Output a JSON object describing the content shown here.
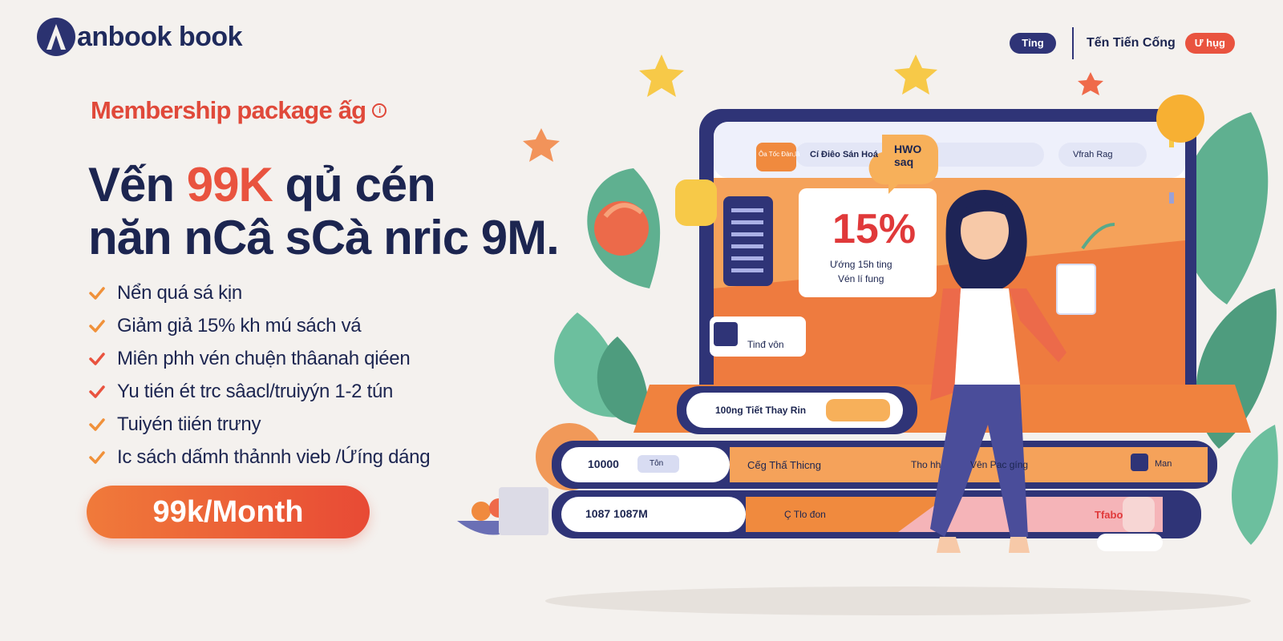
{
  "brand": {
    "name": "anbook book"
  },
  "nav": {
    "pill_label": "Tỉng",
    "link_label": "Tến Tiến Cống",
    "cta_label": "Ư hụg"
  },
  "hero": {
    "eyebrow": "Membership package ấg",
    "eyebrow_icon": "info-icon",
    "headline_part1": "Vến ",
    "headline_accent": "99K",
    "headline_part2": " qủ cén",
    "headline_line2": "năn nCâ sCà nric 9M.",
    "features": [
      "Nển quá sá kịn",
      "Giảm giả 15% kh mú sách vá",
      "Miên phh vén chuện thâanah qiéen",
      "Yu tién ét trc sâacl/truiyýn 1-2 tún",
      "Tuiyén tiién trưny",
      "Ic sách dấmh thảnnh vieb /Ứíng dáng"
    ],
    "price_button": "99k/Month"
  },
  "illustration": {
    "browser_bar_text": "Cí Điêo Sán Hoá",
    "browser_search_text": "Vfrah Rag",
    "tag_top_left": "Ôa Tốc Đàn,lâ",
    "bubble_text": "HWO saq",
    "discount_value": "15%",
    "discount_caption_1": "Ướng 15h ting",
    "discount_caption_2": "Vén lí fung",
    "card_label": "Tinđ vôn",
    "book1_label": "100ng Tiết Thay Rin",
    "book2_num": "10000",
    "book2_tag": "Tôn",
    "book2_title": "Cếg Thấ Thicng",
    "book2_mid": "Tho hh",
    "book2_right": "Vên Pac gíng",
    "book2_end": "Man",
    "book3_nums": "1087 1087M",
    "book3_title": "Ç Tlo đon",
    "book3_right": "Tfabo",
    "colors": {
      "navy": "#2f3477",
      "orange": "#f08a3e",
      "red": "#e9533f",
      "star": "#f7c948",
      "leaf": "#58a98a"
    }
  }
}
